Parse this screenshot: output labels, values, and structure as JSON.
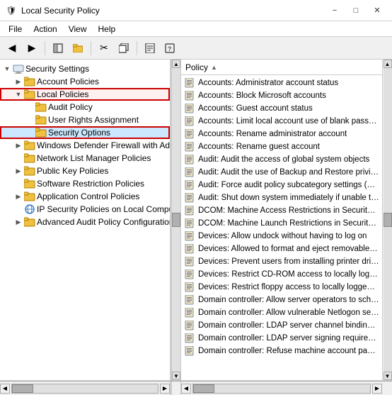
{
  "window": {
    "title": "Local Security Policy",
    "icon": "🛡"
  },
  "menu": {
    "items": [
      "File",
      "Action",
      "View",
      "Help"
    ]
  },
  "toolbar": {
    "buttons": [
      {
        "name": "back",
        "icon": "◀"
      },
      {
        "name": "forward",
        "icon": "▶"
      },
      {
        "name": "folder1",
        "icon": "📁"
      },
      {
        "name": "folder2",
        "icon": "📂"
      },
      {
        "name": "cut",
        "icon": "✂"
      },
      {
        "name": "copy",
        "icon": "📋"
      },
      {
        "name": "properties",
        "icon": "ℹ"
      },
      {
        "name": "help",
        "icon": "?"
      }
    ]
  },
  "tree": {
    "items": [
      {
        "id": "security-settings",
        "label": "Security Settings",
        "level": 0,
        "expanded": true,
        "type": "root"
      },
      {
        "id": "account-policies",
        "label": "Account Policies",
        "level": 1,
        "expanded": false,
        "type": "folder"
      },
      {
        "id": "local-policies",
        "label": "Local Policies",
        "level": 1,
        "expanded": true,
        "type": "folder",
        "highlighted": true
      },
      {
        "id": "audit-policy",
        "label": "Audit Policy",
        "level": 2,
        "expanded": false,
        "type": "folder"
      },
      {
        "id": "user-rights",
        "label": "User Rights Assignment",
        "level": 2,
        "expanded": false,
        "type": "folder"
      },
      {
        "id": "security-options",
        "label": "Security Options",
        "level": 2,
        "expanded": false,
        "type": "folder",
        "selected": true
      },
      {
        "id": "windows-defender",
        "label": "Windows Defender Firewall with Adva...",
        "level": 1,
        "expanded": false,
        "type": "folder"
      },
      {
        "id": "network-list",
        "label": "Network List Manager Policies",
        "level": 1,
        "expanded": false,
        "type": "folder"
      },
      {
        "id": "public-key",
        "label": "Public Key Policies",
        "level": 1,
        "expanded": false,
        "type": "folder"
      },
      {
        "id": "software-restriction",
        "label": "Software Restriction Policies",
        "level": 1,
        "expanded": false,
        "type": "folder"
      },
      {
        "id": "app-control",
        "label": "Application Control Policies",
        "level": 1,
        "expanded": false,
        "type": "folder"
      },
      {
        "id": "ip-security",
        "label": "IP Security Policies on Local Compute...",
        "level": 1,
        "expanded": false,
        "type": "ip"
      },
      {
        "id": "advanced-audit",
        "label": "Advanced Audit Policy Configuration",
        "level": 1,
        "expanded": false,
        "type": "folder"
      }
    ]
  },
  "policy_panel": {
    "header": "Policy",
    "items": [
      "Accounts: Administrator account status",
      "Accounts: Block Microsoft accounts",
      "Accounts: Guest account status",
      "Accounts: Limit local account use of blank passwo...",
      "Accounts: Rename administrator account",
      "Accounts: Rename guest account",
      "Audit: Audit the access of global system objects",
      "Audit: Audit the use of Backup and Restore privile...",
      "Audit: Force audit policy subcategory settings (Win...",
      "Audit: Shut down system immediately if unable to lo...",
      "DCOM: Machine Access Restrictions in Security De...",
      "DCOM: Machine Launch Restrictions in Security De...",
      "Devices: Allow undock without having to log on",
      "Devices: Allowed to format and eject removable m...",
      "Devices: Prevent users from installing printer driver...",
      "Devices: Restrict CD-ROM access to locally logged-...",
      "Devices: Restrict floppy access to locally logged-on...",
      "Domain controller: Allow server operators to sched...",
      "Domain controller: Allow vulnerable Netlogon secu...",
      "Domain controller: LDAP server channel binding to...",
      "Domain controller: LDAP server signing requiremen...",
      "Domain controller: Refuse machine account passw..."
    ]
  }
}
